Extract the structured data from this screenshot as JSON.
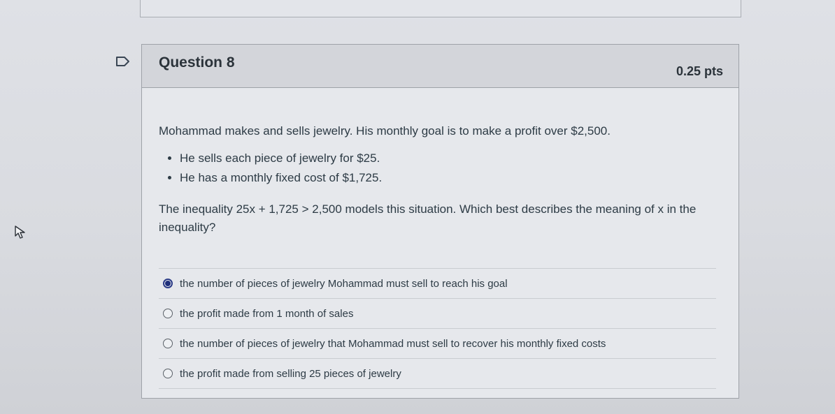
{
  "question": {
    "title": "Question 8",
    "points": "0.25 pts",
    "intro": "Mohammad makes and sells jewelry. His monthly goal is to make a profit over $2,500.",
    "bullets": [
      "He sells each piece of jewelry for $25.",
      "He has a monthly fixed cost of $1,725."
    ],
    "prompt": "The inequality 25x + 1,725 > 2,500 models this situation. Which best describes the meaning of x in the inequality?",
    "answers": [
      {
        "label": "the number of pieces of jewelry Mohammad must sell to reach his goal",
        "selected": true
      },
      {
        "label": "the profit made from 1 month of sales",
        "selected": false
      },
      {
        "label": "the number of pieces of jewelry that Mohammad must sell to recover his monthly fixed costs",
        "selected": false
      },
      {
        "label": "the profit made from selling 25 pieces of jewelry",
        "selected": false
      }
    ]
  },
  "icons": {
    "flag": "flag-question-icon",
    "cursor": "mouse-pointer-icon"
  },
  "colors": {
    "selected_radio": "#1f2f7a",
    "header_bg": "#d3d5da"
  }
}
